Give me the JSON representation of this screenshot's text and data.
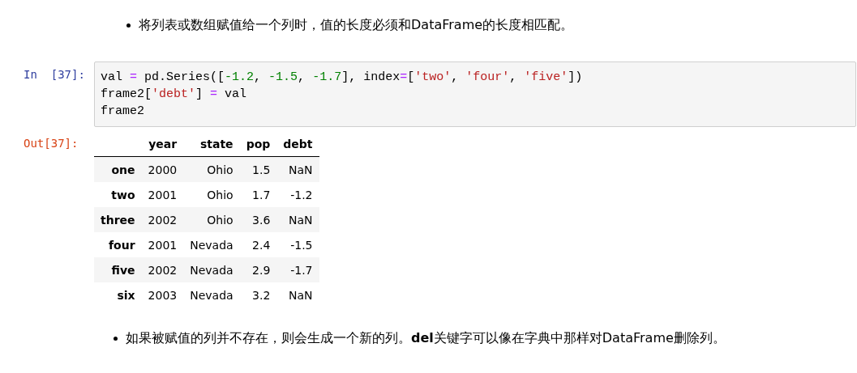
{
  "bullets_top": [
    "将列表或数组赋值给一个列时，值的长度必须和DataFrame的长度相匹配。"
  ],
  "cell": {
    "in_prompt": "In  [37]:",
    "out_prompt": "Out[37]:",
    "code_lines": [
      [
        {
          "kind": "plain",
          "text": "val "
        },
        {
          "kind": "op",
          "text": "="
        },
        {
          "kind": "plain",
          "text": " pd.Series(["
        },
        {
          "kind": "num",
          "text": "-1.2"
        },
        {
          "kind": "plain",
          "text": ", "
        },
        {
          "kind": "num",
          "text": "-1.5"
        },
        {
          "kind": "plain",
          "text": ", "
        },
        {
          "kind": "num",
          "text": "-1.7"
        },
        {
          "kind": "plain",
          "text": "], index"
        },
        {
          "kind": "op",
          "text": "="
        },
        {
          "kind": "plain",
          "text": "["
        },
        {
          "kind": "str",
          "text": "'two'"
        },
        {
          "kind": "plain",
          "text": ", "
        },
        {
          "kind": "str",
          "text": "'four'"
        },
        {
          "kind": "plain",
          "text": ", "
        },
        {
          "kind": "str",
          "text": "'five'"
        },
        {
          "kind": "plain",
          "text": "])"
        }
      ],
      [
        {
          "kind": "plain",
          "text": "frame2["
        },
        {
          "kind": "str",
          "text": "'debt'"
        },
        {
          "kind": "plain",
          "text": "] "
        },
        {
          "kind": "op",
          "text": "="
        },
        {
          "kind": "plain",
          "text": " val"
        }
      ],
      [
        {
          "kind": "plain",
          "text": "frame2"
        }
      ]
    ]
  },
  "table": {
    "columns": [
      "",
      "year",
      "state",
      "pop",
      "debt"
    ],
    "rows": [
      [
        "one",
        "2000",
        "Ohio",
        "1.5",
        "NaN"
      ],
      [
        "two",
        "2001",
        "Ohio",
        "1.7",
        "-1.2"
      ],
      [
        "three",
        "2002",
        "Ohio",
        "3.6",
        "NaN"
      ],
      [
        "four",
        "2001",
        "Nevada",
        "2.4",
        "-1.5"
      ],
      [
        "five",
        "2002",
        "Nevada",
        "2.9",
        "-1.7"
      ],
      [
        "six",
        "2003",
        "Nevada",
        "3.2",
        "NaN"
      ]
    ]
  },
  "bullets_bottom": [
    "如果被赋值的列并不存在，则会生成一个新的列。**del**关键字可以像在字典中那样对DataFrame删除列。"
  ]
}
